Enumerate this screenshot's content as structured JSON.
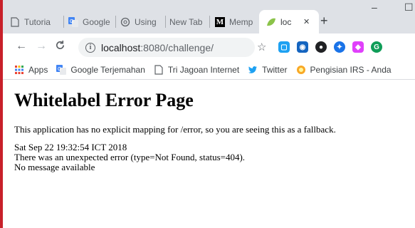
{
  "browser": {
    "tabs": [
      {
        "label": "Tutoria",
        "icon": "document-icon"
      },
      {
        "label": "Google",
        "icon": "google-translate-icon"
      },
      {
        "label": "Using",
        "icon": "openai-icon"
      },
      {
        "label": "New Tab",
        "icon": ""
      },
      {
        "label": "Memp",
        "icon": "medium-icon"
      },
      {
        "label": "loc",
        "icon": "spring-leaf-icon",
        "active": true
      }
    ],
    "tab_close": "✕",
    "new_tab": "+",
    "window_min": "–",
    "window_max": "☐",
    "address": "localhost:8080/challenge/",
    "address_host": "localhost",
    "address_rest": ":8080/challenge/"
  },
  "bookmarks": [
    {
      "label": "Apps",
      "icon": "apps-grid-icon"
    },
    {
      "label": "Google Terjemahan",
      "icon": "google-translate-icon"
    },
    {
      "label": "Tri Jagoan Internet",
      "icon": "document-icon"
    },
    {
      "label": "Twitter",
      "icon": "twitter-icon"
    },
    {
      "label": "Pengisian IRS - Anda",
      "icon": "irs-icon"
    }
  ],
  "page": {
    "title": "Whitelabel Error Page",
    "description": "This application has no explicit mapping for /error, so you are seeing this as a fallback.",
    "timestamp": "Sat Sep 22 19:32:54 ICT 2018",
    "error_line": "There was an unexpected error (type=Not Found, status=404).",
    "message": "No message available"
  },
  "colors": {
    "accent_red": "#c8202a",
    "titlebar": "#dee1e6",
    "omnibox": "#f1f3f4"
  }
}
